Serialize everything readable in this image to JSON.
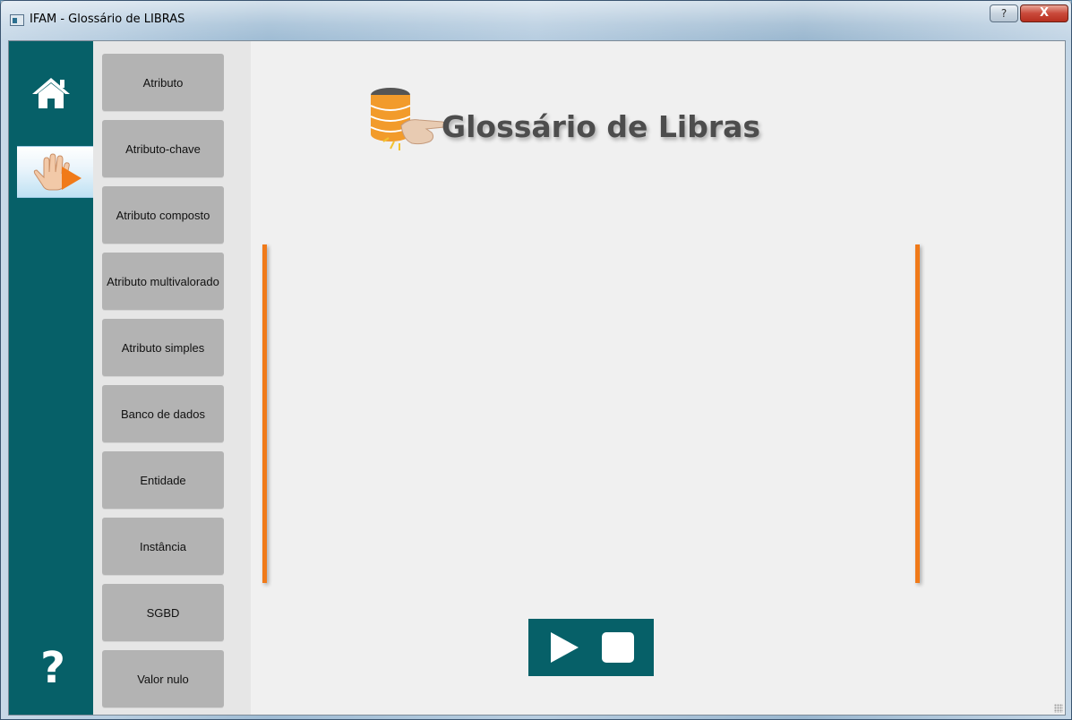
{
  "window": {
    "title": "IFAM - Glossário de LIBRAS",
    "help_glyph": "?",
    "close_glyph": "X"
  },
  "nav": {
    "home_icon": "home-icon",
    "glossary_icon": "hand-play-icon",
    "help_label": "?"
  },
  "terms": [
    "Atributo",
    "Atributo-chave",
    "Atributo composto",
    "Atributo multivalorado",
    "Atributo simples",
    "Banco de dados",
    "Entidade",
    "Instância",
    "SGBD",
    "Valor nulo"
  ],
  "main": {
    "heading": "Glossário de Libras",
    "logo_icon": "database-hand-icon"
  },
  "player": {
    "play_icon": "play-icon",
    "stop_icon": "stop-icon"
  },
  "colors": {
    "teal": "#066068",
    "accent_orange": "#f07a19",
    "term_button": "#b3b3b3",
    "selected_nav": "#e9f4fb"
  }
}
